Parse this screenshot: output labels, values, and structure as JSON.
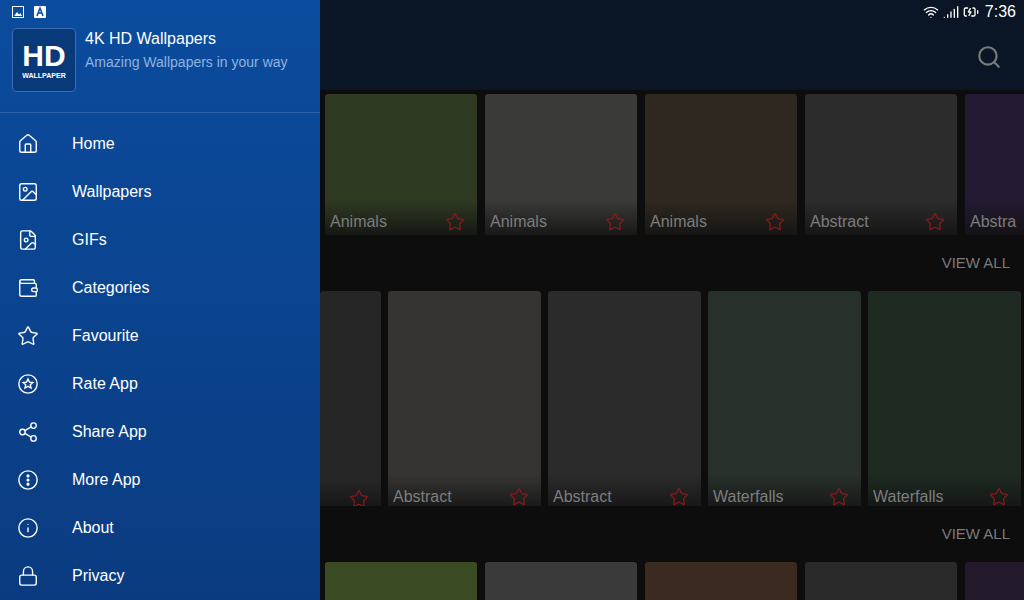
{
  "status_bar": {
    "time": "7:36"
  },
  "app": {
    "logo": {
      "main": "HD",
      "sub": "WALLPAPER"
    },
    "title": "4K HD Wallpapers",
    "subtitle": "Amazing Wallpapers in your way"
  },
  "drawer": {
    "items": [
      {
        "label": "Home"
      },
      {
        "label": "Wallpapers"
      },
      {
        "label": "GIFs"
      },
      {
        "label": "Categories"
      },
      {
        "label": "Favourite"
      },
      {
        "label": "Rate App"
      },
      {
        "label": "Share App"
      },
      {
        "label": "More App"
      },
      {
        "label": "About"
      },
      {
        "label": "Privacy"
      }
    ]
  },
  "sections": [
    {
      "cards": [
        {
          "label": "Animals",
          "favourite": false
        },
        {
          "label": "Animals",
          "favourite": false
        },
        {
          "label": "Animals",
          "favourite": false
        },
        {
          "label": "Abstract",
          "favourite": false
        },
        {
          "label": "Abstra",
          "favourite": false
        }
      ],
      "link": "VIEW ALL"
    },
    {
      "cards": [
        {
          "label": "",
          "favourite": false
        },
        {
          "label": "Abstract",
          "favourite": false
        },
        {
          "label": "Abstract",
          "favourite": false
        },
        {
          "label": "Waterfalls",
          "favourite": false
        },
        {
          "label": "Waterfalls",
          "favourite": false
        }
      ],
      "link": "VIEW ALL"
    }
  ]
}
